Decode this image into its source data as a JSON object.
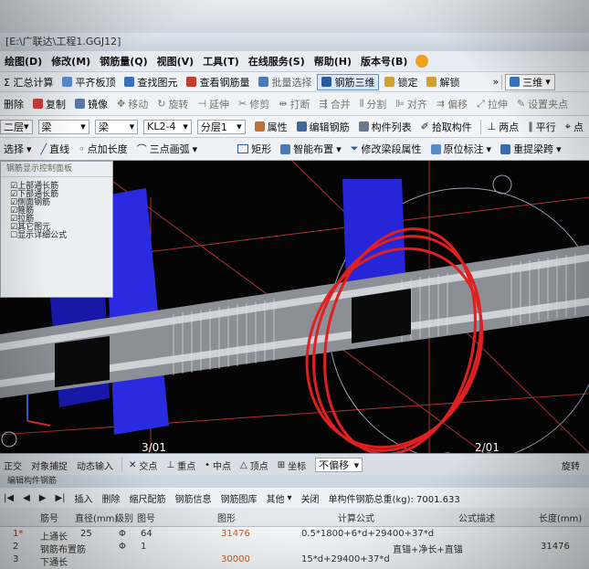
{
  "window": {
    "title": "[E:\\广联达\\工程1.GGJ12]"
  },
  "menu": [
    "绘图(D)",
    "修改(M)",
    "钢筋量(Q)",
    "视图(V)",
    "工具(T)",
    "在线服务(S)",
    "帮助(H)",
    "版本号(B)"
  ],
  "toolbar1": [
    "Σ 汇总计算",
    "平齐板顶",
    "查找图元",
    "查看钢筋量",
    "批量选择",
    "钢筋三维",
    "锁定",
    "解锁"
  ],
  "view_mode": "三维",
  "toolbar2": [
    "删除",
    "复制",
    "镜像",
    "移动",
    "旋转",
    "延伸",
    "修剪",
    "打断",
    "合并",
    "分割",
    "对齐",
    "偏移",
    "拉伸",
    "设置夹点"
  ],
  "selectors": {
    "floor": "二层",
    "category": "梁",
    "type": "梁",
    "name": "KL2-4",
    "layer": "分层1"
  },
  "toolbar3": [
    "属性",
    "编辑钢筋",
    "构件列表",
    "拾取构件",
    "两点",
    "平行",
    "点"
  ],
  "toolbar4": [
    "选择",
    "直线",
    "点加长度",
    "三点画弧",
    "矩形",
    "智能布置",
    "修改梁段属性",
    "原位标注",
    "重提梁跨"
  ],
  "panel": {
    "title": "钢筋显示控制面板",
    "items": [
      "上部通长筋",
      "下部通长筋",
      "侧面钢筋",
      "箍筋",
      "拉筋",
      "其它图元",
      "显示详细公式"
    ]
  },
  "axis_labels": {
    "left": "3/01",
    "right": "2/01"
  },
  "snap_bar": [
    "正交",
    "对象捕捉",
    "动态输入",
    "交点",
    "重点",
    "中点",
    "顶点",
    "坐标",
    "不偏移"
  ],
  "snap_right": "旋转",
  "edit_panel": {
    "title": "编辑构件钢筋",
    "tools": [
      "插入",
      "删除",
      "缩尺配筋",
      "钢筋信息",
      "钢筋图库",
      "其他",
      "关闭"
    ],
    "total_label": "单构件钢筋总重(kg): 7001.633"
  },
  "grid": {
    "columns": [
      "筋号",
      "直径(mm)",
      "级别",
      "图号",
      "图形",
      "计算公式",
      "公式描述",
      "长度(mm)"
    ],
    "rows": [
      {
        "no": "1*",
        "name": "上通长",
        "dia": "25",
        "grade": "Φ",
        "fig": "64",
        "shape": "31476",
        "formula": "0.5*1800+6*d+29400+37*d",
        "desc": "",
        "len": ""
      },
      {
        "no": "2",
        "name": "钢筋布置筋",
        "dia": "",
        "grade": "Φ",
        "fig": "1",
        "shape": "",
        "formula": "",
        "desc": "直锚+净长+直锚",
        "len": "31476"
      },
      {
        "no": "3",
        "name": "下通长",
        "dia": "",
        "grade": "",
        "fig": "",
        "shape": "30000",
        "formula": "15*d+29400+37*d",
        "desc": "",
        "len": ""
      }
    ]
  }
}
